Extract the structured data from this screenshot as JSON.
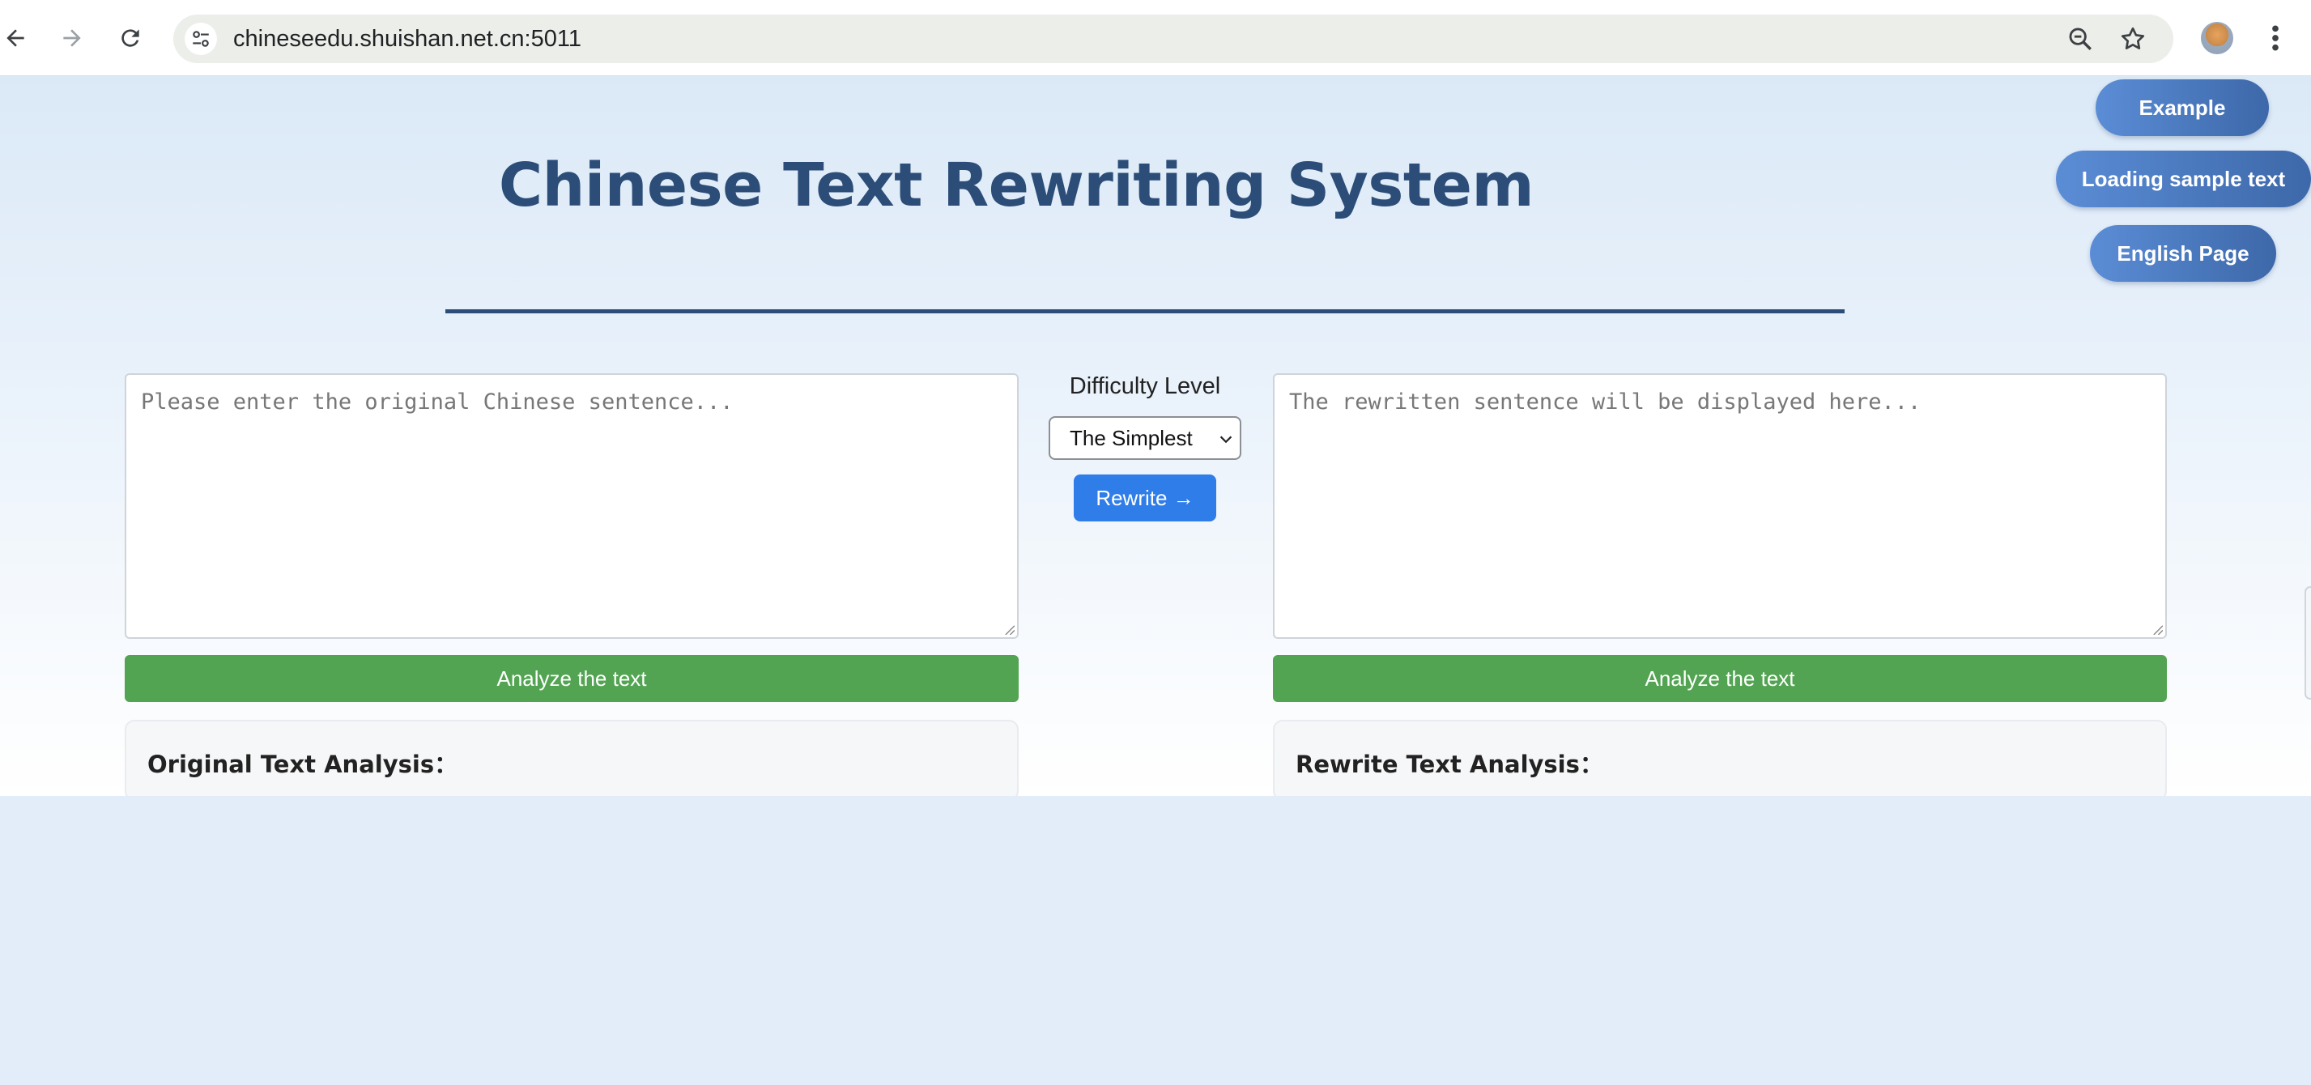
{
  "browser": {
    "url": "chineseedu.shuishan.net.cn:5011",
    "icons": {
      "back": "arrow-left-icon",
      "forward": "arrow-right-icon",
      "reload": "reload-icon",
      "site_info": "tune-icon",
      "zoom": "zoom-out-icon",
      "bookmark": "star-icon",
      "menu": "kebab-menu-icon"
    }
  },
  "page": {
    "title": "Chinese Text Rewriting System",
    "top_buttons": {
      "example": "Example",
      "loading_sample": "Loading sample text",
      "english_page": "English Page"
    },
    "input": {
      "placeholder": "Please enter the original Chinese sentence...",
      "analyze_label": "Analyze the text",
      "analysis_heading": "Original Text Analysis："
    },
    "controls": {
      "difficulty_label": "Difficulty Level",
      "difficulty_selected": "The Simplest",
      "rewrite_label": "Rewrite →"
    },
    "output": {
      "placeholder": "The rewritten sentence will be displayed here...",
      "analyze_label": "Analyze the text",
      "analysis_heading": "Rewrite Text Analysis："
    }
  },
  "colors": {
    "title": "#2b4d78",
    "pill_button": "#4a7bc4",
    "analyze_button": "#52a452",
    "rewrite_button": "#2f7de8",
    "page_background": "#e2edf9"
  }
}
